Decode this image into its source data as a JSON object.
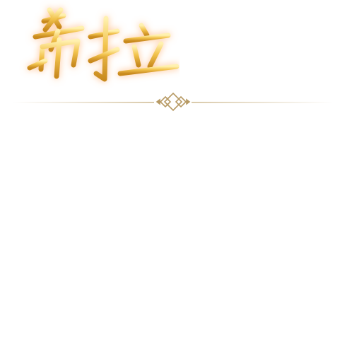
{
  "header": {
    "title": "希拉",
    "logo_icon": "calligraphy-title-icon",
    "accent_color": "#e9b43c",
    "glow_color": "#ffb070"
  },
  "divider": {
    "icon": "diamond-ornament-icon",
    "line_color": "#cdb88e",
    "ornament_color": "#b79a64"
  }
}
